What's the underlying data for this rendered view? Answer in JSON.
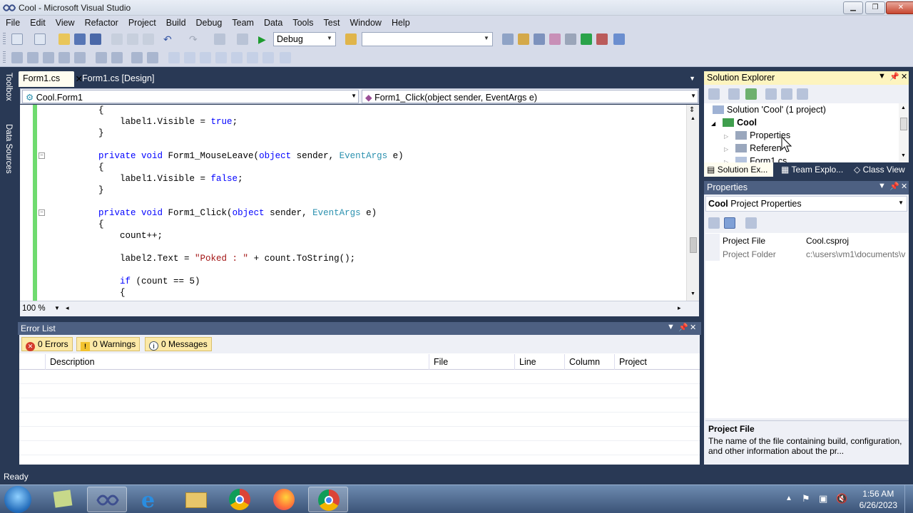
{
  "window": {
    "title": "Cool - Microsoft Visual Studio"
  },
  "menu": [
    "File",
    "Edit",
    "View",
    "Refactor",
    "Project",
    "Build",
    "Debug",
    "Team",
    "Data",
    "Tools",
    "Test",
    "Window",
    "Help"
  ],
  "toolbar": {
    "configuration": "Debug",
    "platform": ""
  },
  "side_tabs": [
    "Toolbox",
    "Data Sources"
  ],
  "editor": {
    "tabs": [
      {
        "label": "Form1.cs",
        "active": true
      },
      {
        "label": "Form1.cs [Design]",
        "active": false
      }
    ],
    "type_selector": "Cool.Form1",
    "member_selector": "Form1_Click(object sender, EventArgs e)",
    "zoom": "100 %",
    "code_lines": [
      "        {",
      "            label1.Visible = true;",
      "        }",
      "",
      "        private void Form1_MouseLeave(object sender, EventArgs e)",
      "        {",
      "            label1.Visible = false;",
      "        }",
      "",
      "        private void Form1_Click(object sender, EventArgs e)",
      "        {",
      "            count++;",
      "",
      "            label2.Text = \"Poked : \" + count.ToString();",
      "",
      "            if (count == 5)",
      "            {"
    ]
  },
  "error_list": {
    "title": "Error List",
    "filters": {
      "errors": "0 Errors",
      "warnings": "0 Warnings",
      "messages": "0 Messages"
    },
    "columns": [
      "Description",
      "File",
      "Line",
      "Column",
      "Project"
    ]
  },
  "solution_explorer": {
    "title": "Solution Explorer",
    "tree": {
      "solution": "Solution 'Cool' (1 project)",
      "project": "Cool",
      "items": [
        "Properties",
        "Referen",
        "Form1.cs"
      ]
    },
    "tabs": [
      "Solution Ex...",
      "Team Explo...",
      "Class View"
    ]
  },
  "properties": {
    "title": "Properties",
    "object_name": "Cool",
    "object_type": "Project Properties",
    "rows": [
      {
        "key": "Project File",
        "value": "Cool.csproj"
      },
      {
        "key": "Project Folder",
        "value": "c:\\users\\vm1\\documents\\v"
      }
    ],
    "description": {
      "heading": "Project File",
      "text": "The name of the file containing build, configuration, and other information about the pr..."
    }
  },
  "status": {
    "text": "Ready"
  },
  "taskbar": {
    "time": "1:56 AM",
    "date": "6/26/2023"
  }
}
